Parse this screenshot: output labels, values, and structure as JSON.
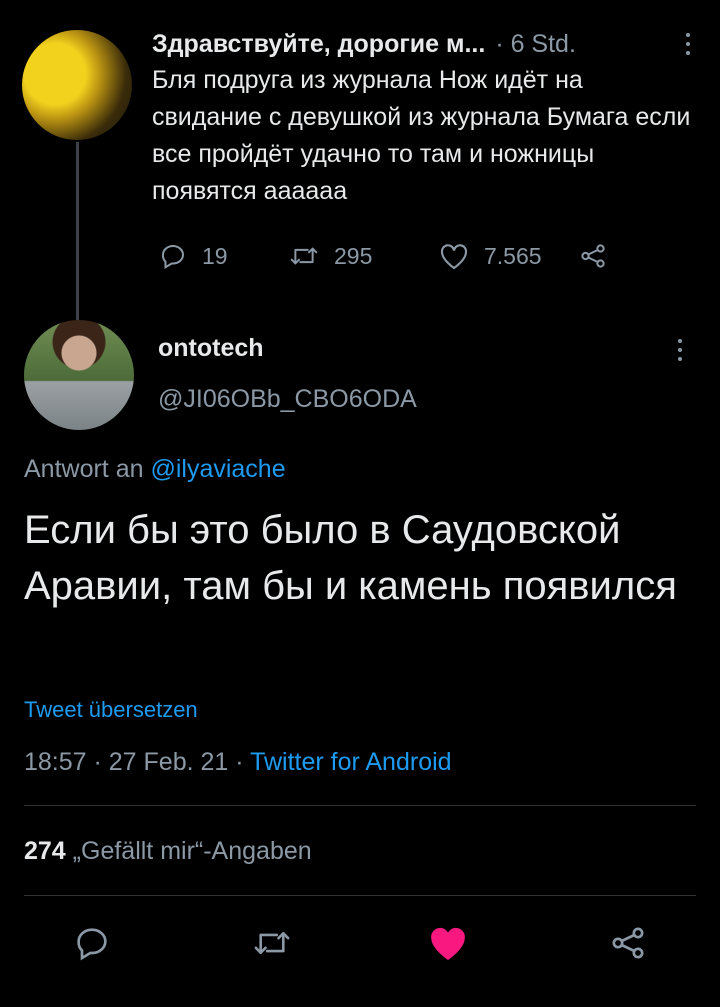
{
  "parent_tweet": {
    "display_name": "Здравствуйте, дорогие м...",
    "time": "· 6 Std.",
    "text": "Бля подруга из журнала Нож идёт на свидание с девушкой из журнала Бумага если все пройдёт удачно то там и ножницы появятся аааааа",
    "replies": "19",
    "retweets": "295",
    "likes": "7.565"
  },
  "main_tweet": {
    "display_name": "ontotech",
    "handle": "@JI06OBb_CBO6ODA",
    "reply_prefix": "Antwort an ",
    "reply_to": "@ilyaviache",
    "text": "Если бы это было в Саудовской Аравии, там бы и камень появился",
    "translate_label": "Tweet übersetzen",
    "timestamp": "18:57 · 27 Feb. 21 · ",
    "client": "Twitter for Android",
    "likes_count": "274",
    "likes_label": "„Gefällt mir“-Angaben"
  },
  "colors": {
    "background": "#000000",
    "text": "#e7e9ea",
    "muted": "#8b98a5",
    "accent": "#1d9bf0",
    "like_active": "#f91880"
  },
  "icons": {
    "reply": "reply-icon",
    "retweet": "retweet-icon",
    "like": "heart-icon",
    "share": "share-icon",
    "more": "more-vertical-icon"
  }
}
